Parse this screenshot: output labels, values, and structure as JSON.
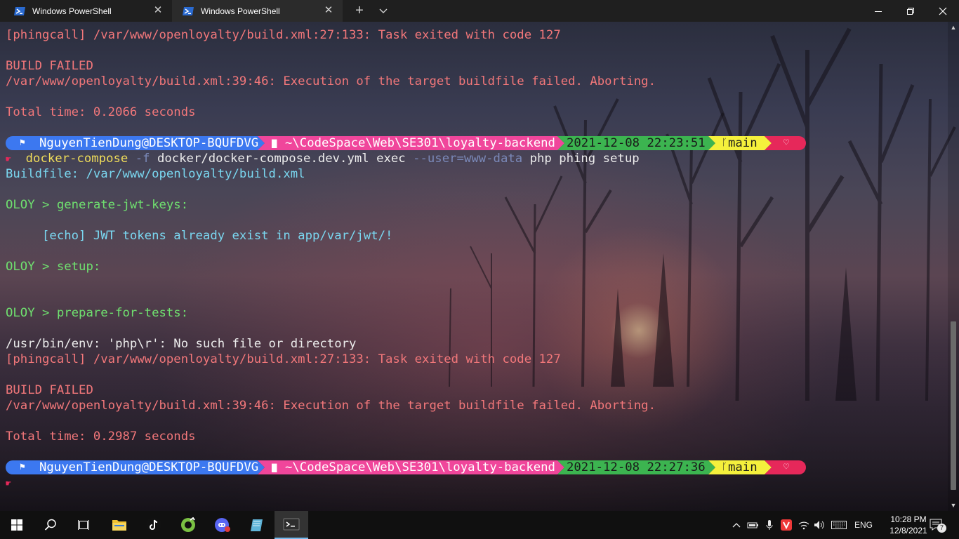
{
  "window": {
    "tabs": [
      {
        "title": "Windows PowerShell",
        "active": false
      },
      {
        "title": "Windows PowerShell",
        "active": true
      }
    ],
    "new_tab_symbol": "+",
    "close_symbol": "✕"
  },
  "terminal": {
    "block1": [
      "[phingcall] /var/www/openloyalty/build.xml:27:133: Task exited with code 127",
      "",
      "BUILD FAILED",
      "/var/www/openloyalty/build.xml:39:46: Execution of the target buildfile failed. Aborting.",
      "",
      "Total time: 0.2066 seconds"
    ],
    "prompt1": {
      "user": "NguyenTienDung@DESKTOP-BQUFDVG",
      "path": "~\\CodeSpace\\Web\\SE301\\loyalty-backend",
      "time": "2021-12-08 22:23:51",
      "branch": "main"
    },
    "command": {
      "exe": "docker-compose",
      "flag": "-f",
      "file": "docker/docker-compose.dev.yml exec",
      "user_flag": "--user=www-data",
      "rest": "php phing setup"
    },
    "buildfile": "Buildfile: /var/www/openloyalty/build.xml",
    "target1": "OLOY > generate-jwt-keys:",
    "echo": "     [echo] JWT tokens already exist in app/var/jwt/!",
    "target2": "OLOY > setup:",
    "target3": "OLOY > prepare-for-tests:",
    "env_error": "/usr/bin/env: 'php\\r': No such file or directory",
    "block2": [
      "[phingcall] /var/www/openloyalty/build.xml:27:133: Task exited with code 127",
      "",
      "BUILD FAILED",
      "/var/www/openloyalty/build.xml:39:46: Execution of the target buildfile failed. Aborting.",
      "",
      "Total time: 0.2987 seconds"
    ],
    "prompt2": {
      "user": "NguyenTienDung@DESKTOP-BQUFDVG",
      "path": "~\\CodeSpace\\Web\\SE301\\loyalty-backend",
      "time": "2021-12-08 22:27:36",
      "branch": "main"
    }
  },
  "taskbar": {
    "apps": [
      "start",
      "search",
      "task-view",
      "file-explorer",
      "tiktok",
      "app-green",
      "discord",
      "notepad",
      "windows-terminal"
    ],
    "language": "ENG",
    "time": "10:28 PM",
    "date": "12/8/2021",
    "notifications": "7"
  },
  "colors": {
    "user_segment": "#3c78f0",
    "path_segment": "#f0469b",
    "time_segment": "#3cb450",
    "branch_segment": "#f5f03c",
    "heart_segment": "#e6285a"
  }
}
